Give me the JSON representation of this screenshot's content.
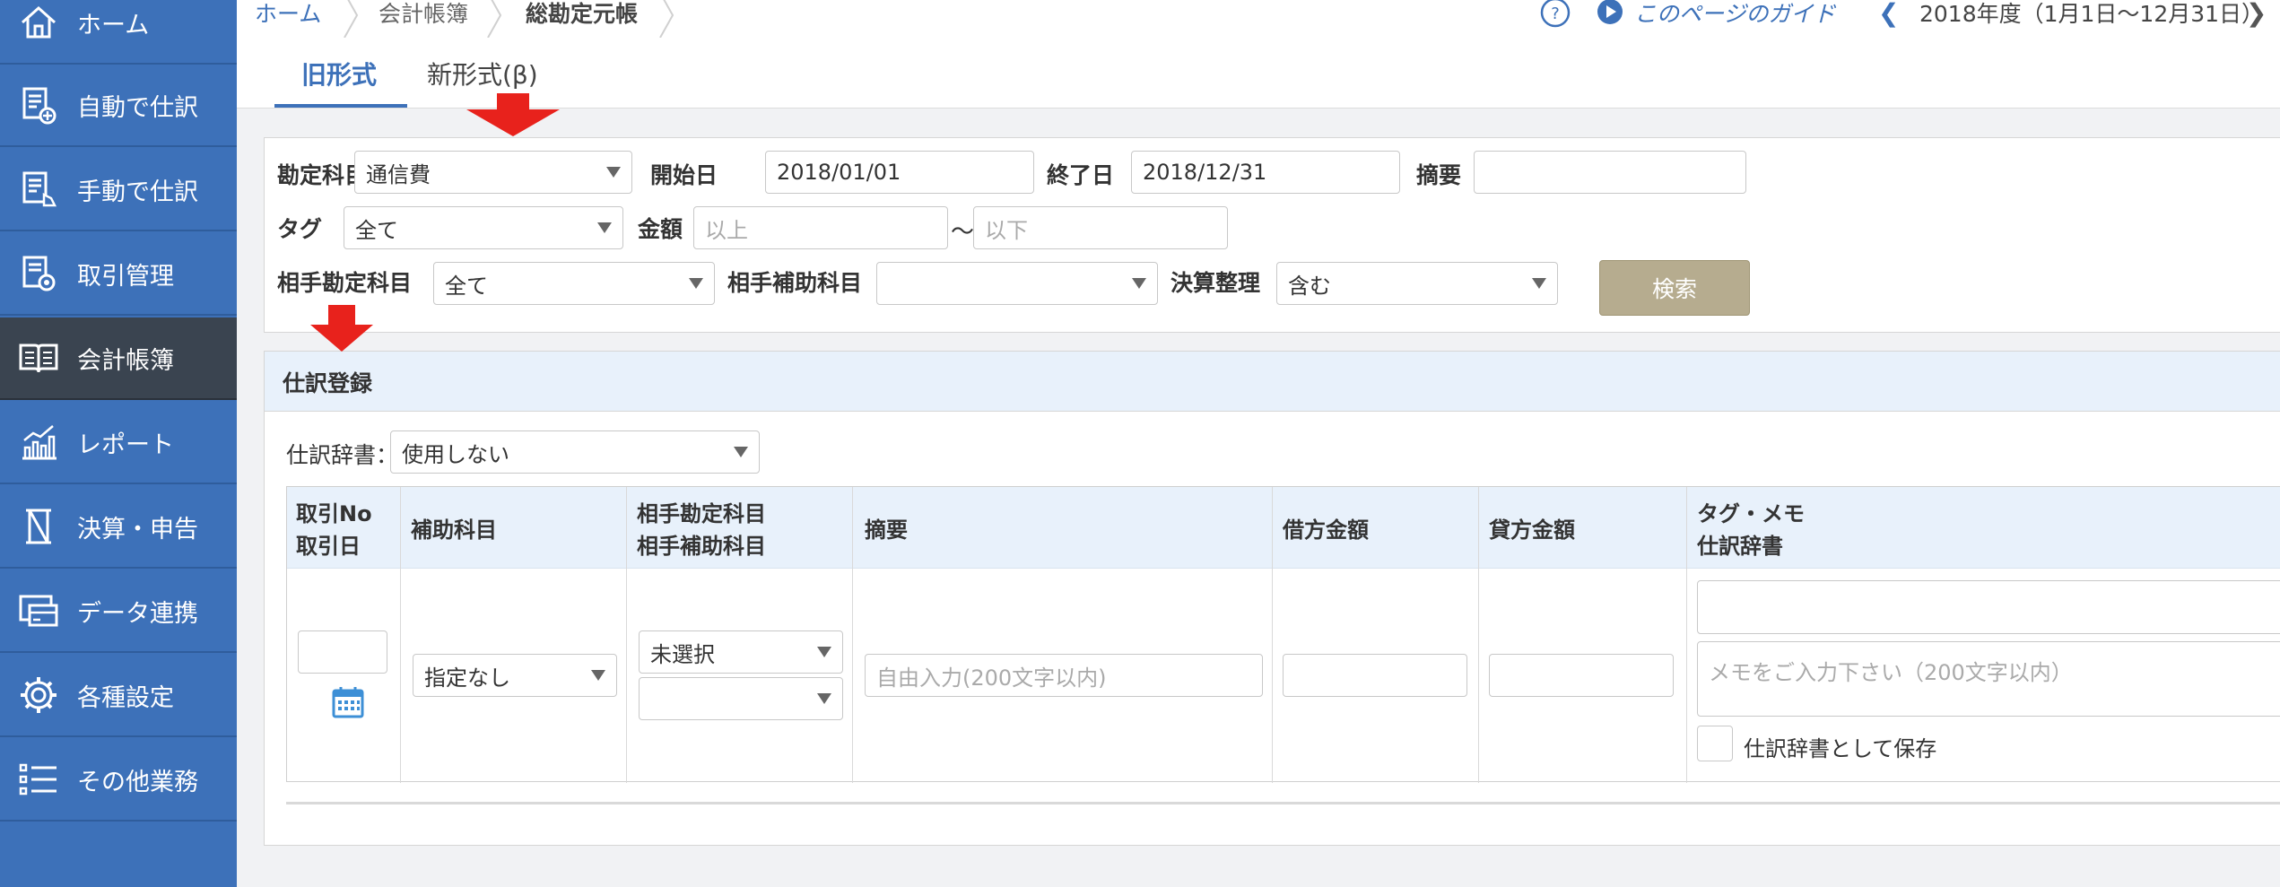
{
  "sidebar": {
    "items": [
      {
        "label": "ホーム",
        "icon": "home-icon"
      },
      {
        "label": "自動で仕訳",
        "icon": "auto-journal-icon"
      },
      {
        "label": "手動で仕訳",
        "icon": "manual-journal-icon"
      },
      {
        "label": "取引管理",
        "icon": "transaction-icon"
      },
      {
        "label": "会計帳簿",
        "icon": "book-icon",
        "active": true
      },
      {
        "label": "レポート",
        "icon": "report-chart-icon"
      },
      {
        "label": "決算・申告",
        "icon": "settlement-icon"
      },
      {
        "label": "データ連携",
        "icon": "data-link-icon"
      },
      {
        "label": "各種設定",
        "icon": "gear-icon"
      },
      {
        "label": "その他業務",
        "icon": "list-icon"
      }
    ]
  },
  "breadcrumb": [
    "ホーム",
    "会計帳簿",
    "総勘定元帳"
  ],
  "header": {
    "guide_label": "このページのガイド",
    "fiscal_year": "2018年度（1月1日〜12月31日）"
  },
  "tabs": [
    {
      "label": "旧形式"
    },
    {
      "label": "新形式(β)"
    }
  ],
  "search": {
    "account_label": "勘定科目",
    "account_value": "通信費",
    "start_label": "開始日",
    "start_value": "2018/01/01",
    "end_label": "終了日",
    "end_value": "2018/12/31",
    "memo_label": "摘要",
    "tag_label": "タグ",
    "tag_value": "全て",
    "amount_label": "金額",
    "amount_min_placeholder": "以上",
    "amount_tilde": "〜",
    "amount_max_placeholder": "以下",
    "counter_account_label": "相手勘定科目",
    "counter_account_value": "全て",
    "counter_sub_label": "相手補助科目",
    "closing_label": "決算整理",
    "closing_value": "含む",
    "search_button": "検索"
  },
  "entry": {
    "title": "仕訳登録",
    "dict_label": "仕訳辞書：",
    "dict_value": "使用しない",
    "columns": [
      {
        "line1": "取引No",
        "line2": "取引日"
      },
      {
        "line1": "補助科目",
        "line2": ""
      },
      {
        "line1": "相手勘定科目",
        "line2": "相手補助科目"
      },
      {
        "line1": "摘要",
        "line2": ""
      },
      {
        "line1": "借方金額",
        "line2": ""
      },
      {
        "line1": "貸方金額",
        "line2": ""
      },
      {
        "line1": "タグ・メモ",
        "line2": "仕訳辞書"
      }
    ],
    "sub_account_value": "指定なし",
    "counter_account_value": "未選択",
    "memo_placeholder": "自由入力(200文字以内)",
    "note_placeholder": "メモをご入力下さい（200文字以内）",
    "save_dict_label": "仕訳辞書として保存"
  },
  "colors": {
    "sidebar": "#3d71b9",
    "sidebar_active": "#3a4450",
    "accent": "#3d71b9",
    "search_button": "#b6ac8f",
    "annotation_arrow": "#e8221c"
  }
}
